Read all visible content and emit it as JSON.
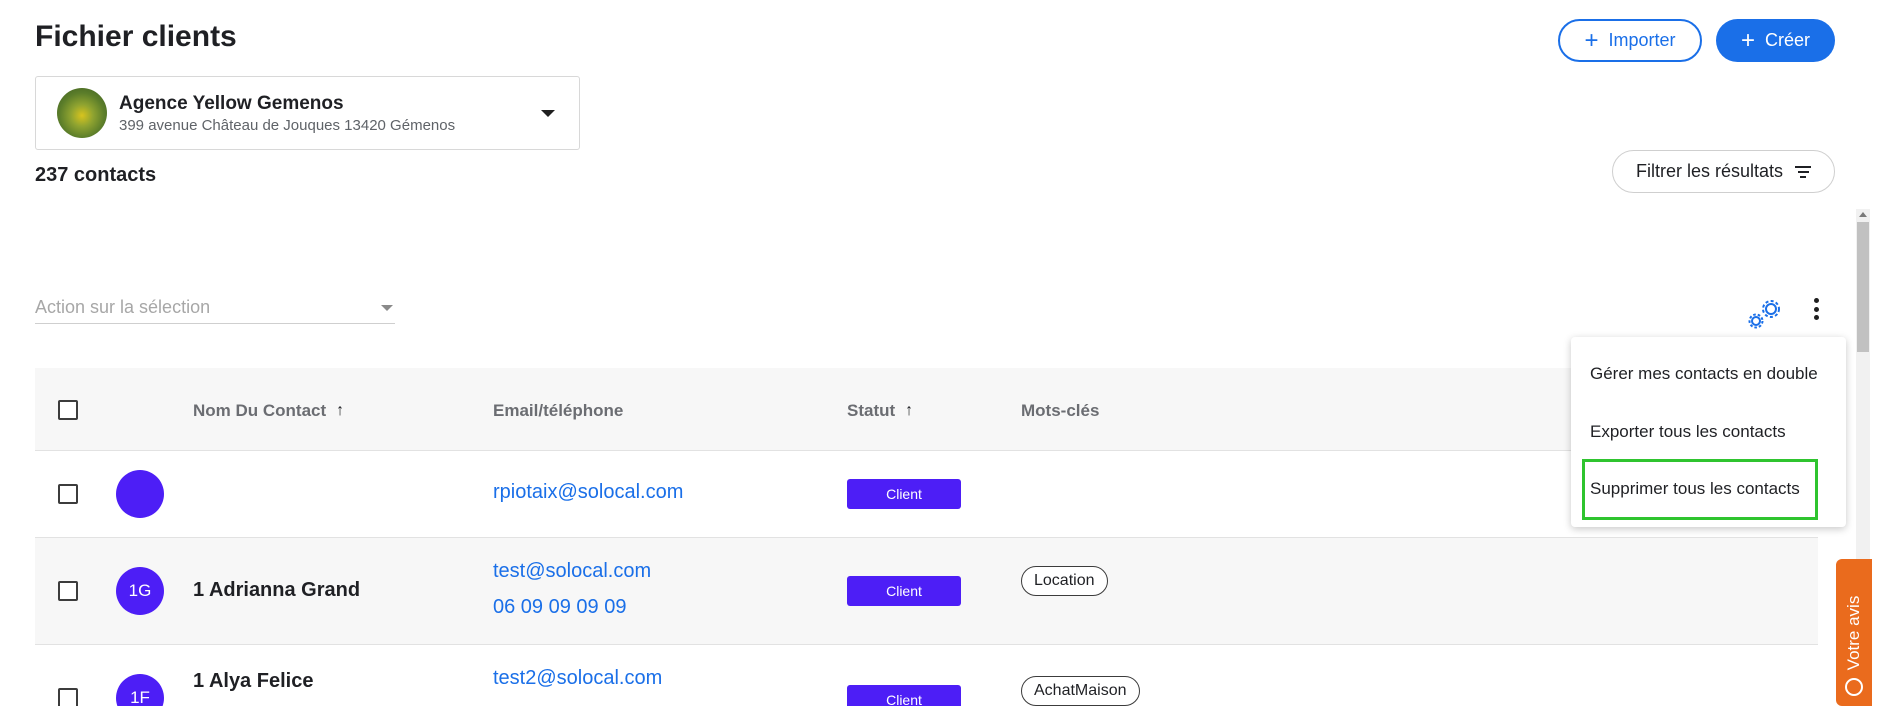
{
  "header": {
    "title": "Fichier clients",
    "import_label": "Importer",
    "create_label": "Créer"
  },
  "agency": {
    "name": "Agence Yellow Gemenos",
    "address": "399 avenue Château de Jouques 13420 Gémenos"
  },
  "contacts_count": "237 contacts",
  "filter_label": "Filtrer les résultats",
  "action_select": {
    "placeholder": "Action sur la sélection"
  },
  "table": {
    "columns": {
      "name": "Nom Du Contact",
      "email_phone": "Email/téléphone",
      "status": "Statut",
      "keywords": "Mots-clés"
    },
    "rows": [
      {
        "initials": "",
        "name": "",
        "email": "rpiotaix@solocal.com",
        "phone": "",
        "status": "Client",
        "tag": ""
      },
      {
        "initials": "1G",
        "name": "1 Adrianna Grand",
        "email": "test@solocal.com",
        "phone": "06 09 09 09 09",
        "status": "Client",
        "tag": "Location"
      },
      {
        "initials": "1F",
        "name": "1 Alya Felice",
        "email": "test2@solocal.com",
        "phone": "",
        "status": "Client",
        "tag": "AchatMaison"
      }
    ]
  },
  "menu": {
    "items": [
      "Gérer mes contacts en double",
      "Exporter tous les contacts",
      "Supprimer tous les contacts"
    ]
  },
  "feedback_label": "Votre avis",
  "colors": {
    "accent": "#1a6fe8",
    "status_badge": "#4d1ef6",
    "highlight": "#2fc42f",
    "feedback": "#ea6b1d"
  },
  "icons": {
    "import": "plus-icon",
    "create": "plus-icon",
    "filter": "filter-lines-icon",
    "settings": "gears-icon",
    "more": "kebab-icon",
    "sort": "arrow-up-icon"
  }
}
